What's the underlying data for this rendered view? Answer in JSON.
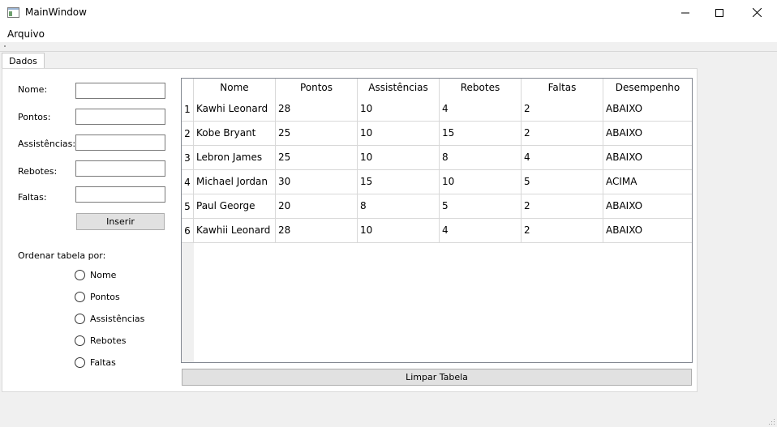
{
  "window": {
    "title": "MainWindow"
  },
  "menu": {
    "items": [
      "Arquivo"
    ]
  },
  "tabs": [
    {
      "label": "Dados"
    }
  ],
  "form": {
    "fields": [
      {
        "label": "Nome:",
        "value": ""
      },
      {
        "label": "Pontos:",
        "value": ""
      },
      {
        "label": "Assistências:",
        "value": ""
      },
      {
        "label": "Rebotes:",
        "value": ""
      },
      {
        "label": "Faltas:",
        "value": ""
      }
    ],
    "insert_button": "Inserir",
    "sort_label": "Ordenar tabela por:",
    "sort_options": [
      "Nome",
      "Pontos",
      "Assistências",
      "Rebotes",
      "Faltas"
    ]
  },
  "table": {
    "columns": [
      "Nome",
      "Pontos",
      "Assistências",
      "Rebotes",
      "Faltas",
      "Desempenho"
    ],
    "row_numbers": [
      "1",
      "2",
      "3",
      "4",
      "5",
      "6"
    ],
    "rows": [
      [
        "Kawhi Leonard",
        "28",
        "10",
        "4",
        "2",
        "ABAIXO"
      ],
      [
        "Kobe Bryant",
        "25",
        "10",
        "15",
        "2",
        "ABAIXO"
      ],
      [
        "Lebron James",
        "25",
        "10",
        "8",
        "4",
        "ABAIXO"
      ],
      [
        "Michael Jordan",
        "30",
        "15",
        "10",
        "5",
        "ACIMA"
      ],
      [
        "Paul George",
        "20",
        "8",
        "5",
        "2",
        "ABAIXO"
      ],
      [
        "Kawhii Leonard",
        "28",
        "10",
        "4",
        "2",
        "ABAIXO"
      ]
    ]
  },
  "clear_button": "Limpar Tabela"
}
